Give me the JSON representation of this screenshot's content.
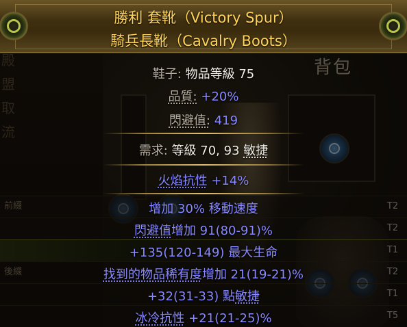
{
  "item": {
    "name": "勝利 套靴（Victory Spur）",
    "base": "騎兵長靴（Cavalry Boots）"
  },
  "properties": {
    "category": "鞋子:",
    "item_level_label": "物品等級",
    "item_level": "75",
    "quality_label": "品質:",
    "quality_value": "+20%",
    "evasion_label": "閃避值:",
    "evasion_value": "419"
  },
  "requirements": {
    "label": "需求:",
    "level_text": "等級 70,",
    "dex_value": "93",
    "dex_label": "敏捷"
  },
  "implicit": {
    "stat": "火焰抗性",
    "value": "+14%"
  },
  "mods": [
    {
      "pre": "增加 30% 移動速度",
      "u": "",
      "post": "",
      "tier": "T2"
    },
    {
      "pre": "",
      "u": "閃避值",
      "post": "增加 91(80-91)%",
      "tier": "T2"
    },
    {
      "pre": "+135(120-149) 最大生命",
      "u": "",
      "post": "",
      "tier": "T1"
    },
    {
      "pre": "",
      "u": "找到的物品稀有度",
      "post": "增加 21(19-21)%",
      "tier": "T2"
    },
    {
      "pre": "+32(31-33) 點",
      "u": "敏捷",
      "post": "",
      "tier": "T1"
    },
    {
      "pre": "",
      "u": "冰冷抗性",
      "post": " +21(21-25)%",
      "tier": "T5"
    }
  ],
  "background": {
    "panel_title": "背包",
    "prefix_label": "前綴",
    "suffix_label": "後綴",
    "left_menu": [
      "殿",
      "盟",
      "取",
      "流"
    ]
  },
  "colors": {
    "header_text": "#ffd35a",
    "magic_blue": "#8888ff",
    "label_grey": "#bab2a4",
    "value_white": "#f0ede6"
  }
}
